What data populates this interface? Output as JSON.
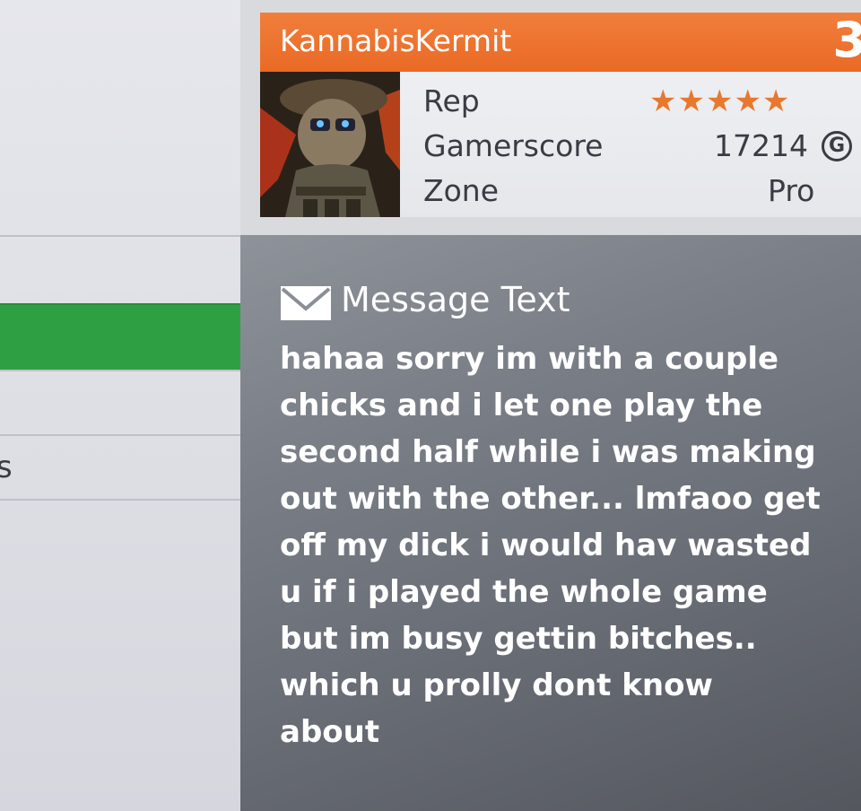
{
  "left_menu": {
    "partial_letter": "s"
  },
  "gamer_card": {
    "gamertag": "KannabisKermit",
    "rep_level_partial": "3",
    "stats": {
      "rep_label": "Rep",
      "rep_stars": "★★★★★",
      "gamerscore_label": "Gamerscore",
      "gamerscore_value": "17214",
      "gamerscore_icon": "G",
      "zone_label": "Zone",
      "zone_value": "Pro"
    }
  },
  "message": {
    "heading": "Message Text",
    "lines": [
      "hahaa sorry im with a couple",
      "chicks and i let one play the",
      "second half while i was making",
      "out with the other... lmfaoo get",
      "off my dick i would hav wasted",
      "u if i played the whole game",
      "but im busy gettin bitches..",
      "which u prolly dont know",
      "about"
    ]
  },
  "colors": {
    "gamertag_bar": "#ed7530",
    "selected_menu_item": "#2ea043",
    "rep_stars": "#e8782d"
  }
}
